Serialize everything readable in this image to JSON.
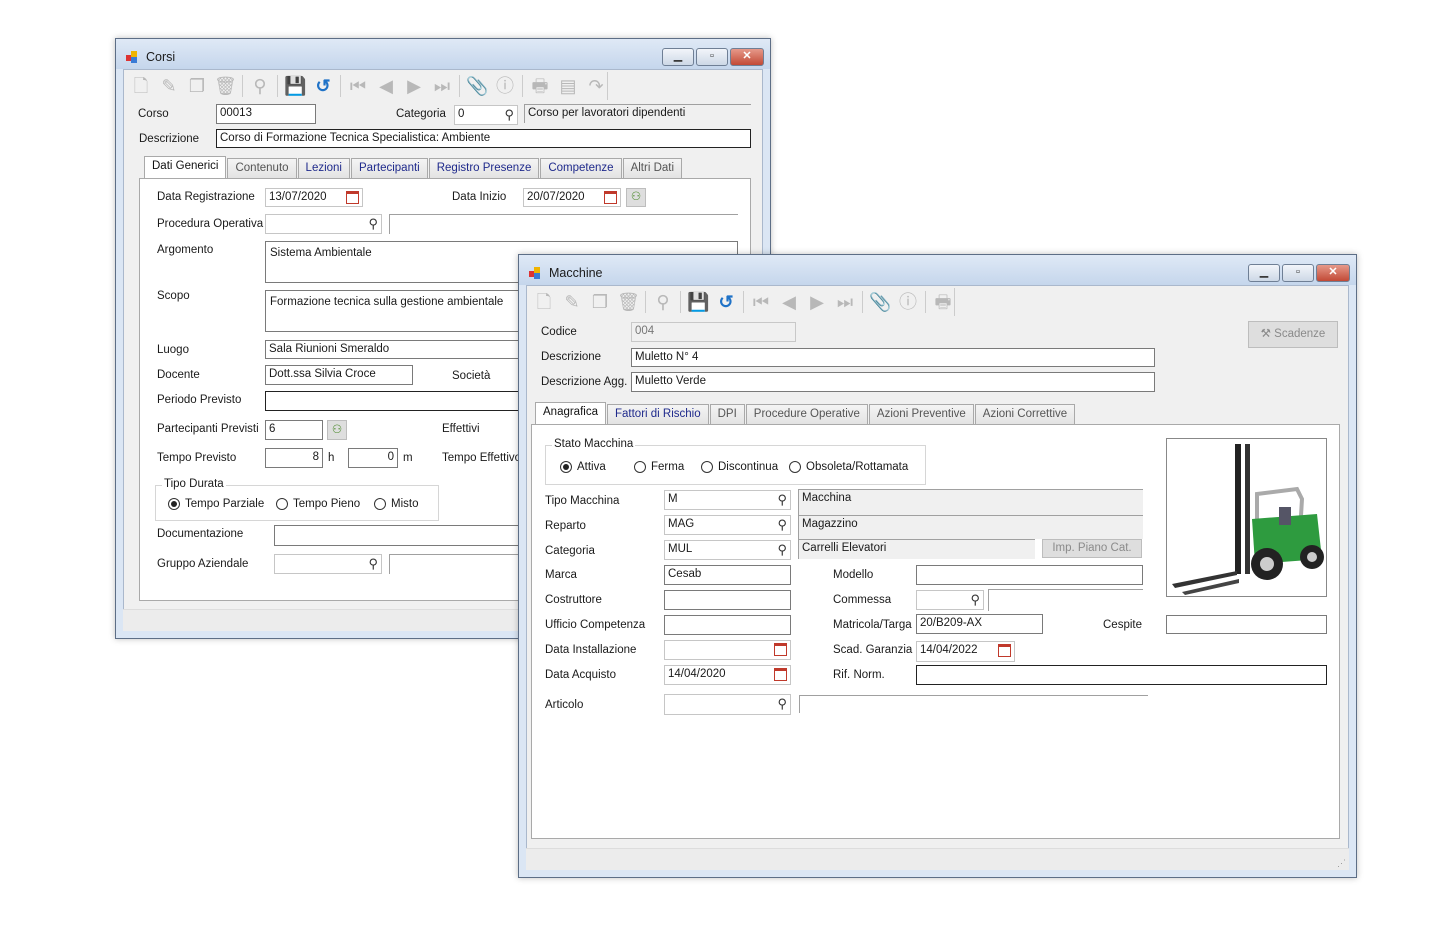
{
  "toolbar_icons": [
    "new-document-icon",
    "edit-icon",
    "copy-icon",
    "delete-icon",
    "search-icon",
    "save-icon",
    "undo-icon",
    "first-record-icon",
    "previous-record-icon",
    "next-record-icon",
    "last-record-icon",
    "attachment-icon",
    "info-icon",
    "print-icon",
    "report-icon",
    "redo-icon"
  ],
  "colors": {
    "save": "#7b3fa6",
    "undo": "#1f72c7",
    "title_bar": "#c5d6ec",
    "close": "#c24a36"
  },
  "corsi": {
    "title": "Corsi",
    "corso_label": "Corso",
    "corso_value": "00013",
    "categoria_label": "Categoria",
    "categoria_value": "0",
    "categoria_desc": "Corso per lavoratori dipendenti",
    "descrizione_label": "Descrizione",
    "descrizione_value": "Corso di Formazione Tecnica Specialistica: Ambiente",
    "tabs": [
      "Dati Generici",
      "Contenuto",
      "Lezioni",
      "Partecipanti",
      "Registro Presenze",
      "Competenze",
      "Altri Dati"
    ],
    "selected_tab": "Dati Generici",
    "form": {
      "data_registrazione_label": "Data Registrazione",
      "data_registrazione": "13/07/2020",
      "data_inizio_label": "Data Inizio",
      "data_inizio": "20/07/2020",
      "procedura_label": "Procedura Operativa",
      "procedura": "",
      "argomento_label": "Argomento",
      "argomento": "Sistema Ambientale",
      "scopo_label": "Scopo",
      "scopo": "Formazione tecnica sulla gestione ambientale",
      "luogo_label": "Luogo",
      "luogo": "Sala Riunioni Smeraldo",
      "docente_label": "Docente",
      "docente": "Dott.ssa Silvia Croce",
      "societa_label": "Società",
      "periodo_label": "Periodo Previsto",
      "periodo": "",
      "partecipanti_label": "Partecipanti Previsti",
      "partecipanti": "6",
      "effettivi_label": "Effettivi",
      "tempo_label": "Tempo Previsto",
      "tempo_h": "8",
      "h_unit": "h",
      "tempo_m": "0",
      "m_unit": "m",
      "tempo_effettivo_label": "Tempo Effettivo",
      "tipo_durata_label": "Tipo Durata",
      "tipo_durata_options": [
        "Tempo Parziale",
        "Tempo Pieno",
        "Misto"
      ],
      "tipo_durata_selected": "Tempo Parziale",
      "documentazione_label": "Documentazione",
      "documentazione": "",
      "gruppo_label": "Gruppo Aziendale",
      "gruppo": ""
    }
  },
  "macchine": {
    "title": "Macchine",
    "codice_label": "Codice",
    "codice_value": "004",
    "scadenze_button": "Scadenze",
    "descrizione_label": "Descrizione",
    "descrizione_value": "Muletto N° 4",
    "descrizione_agg_label": "Descrizione Agg.",
    "descrizione_agg_value": "Muletto Verde",
    "tabs": [
      "Anagrafica",
      "Fattori di Rischio",
      "DPI",
      "Procedure Operative",
      "Azioni Preventive",
      "Azioni Correttive"
    ],
    "selected_tab": "Anagrafica",
    "form": {
      "stato_label": "Stato Macchina",
      "stato_options": [
        "Attiva",
        "Ferma",
        "Discontinua",
        "Obsoleta/Rottamata"
      ],
      "stato_selected": "Attiva",
      "tipo_label": "Tipo Macchina",
      "tipo_code": "M",
      "tipo_desc": "Macchina",
      "reparto_label": "Reparto",
      "reparto_code": "MAG",
      "reparto_desc": "Magazzino",
      "categoria_label": "Categoria",
      "categoria_code": "MUL",
      "categoria_desc": "Carrelli Elevatori",
      "imp_piano_button": "Imp. Piano Cat.",
      "marca_label": "Marca",
      "marca": "Cesab",
      "modello_label": "Modello",
      "modello": "",
      "costruttore_label": "Costruttore",
      "costruttore": "",
      "commessa_label": "Commessa",
      "commessa": "",
      "ufficio_label": "Ufficio Competenza",
      "ufficio": "",
      "matricola_label": "Matricola/Targa",
      "matricola": "20/B209-AX",
      "cespite_label": "Cespite",
      "cespite": "",
      "data_installazione_label": "Data Installazione",
      "data_installazione": "",
      "scad_garanzia_label": "Scad. Garanzia",
      "scad_garanzia": "14/04/2022",
      "data_acquisto_label": "Data Acquisto",
      "data_acquisto": "14/04/2020",
      "rif_norm_label": "Rif. Norm.",
      "rif_norm": "",
      "articolo_label": "Articolo",
      "articolo": ""
    }
  }
}
